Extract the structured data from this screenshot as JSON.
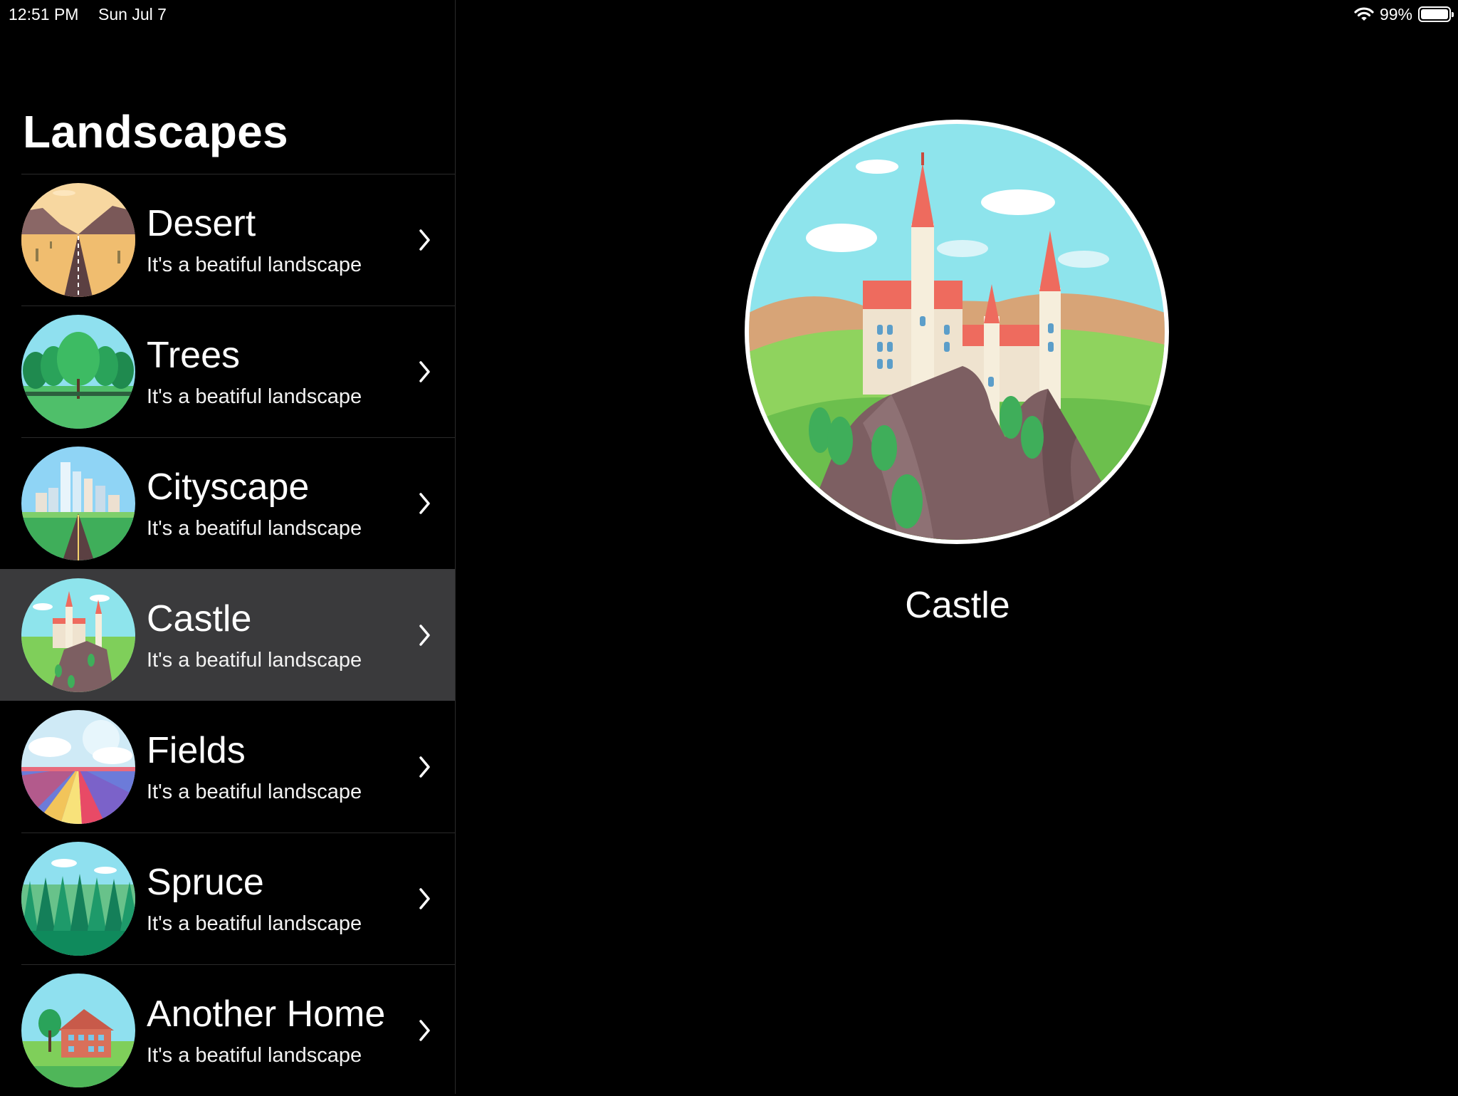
{
  "status_bar": {
    "time": "12:51 PM",
    "date": "Sun Jul 7",
    "battery": "99%",
    "battery_level": 0.99
  },
  "sidebar": {
    "title": "Landscapes",
    "items": [
      {
        "title": "Desert",
        "subtitle": "It's a beatiful landscape",
        "icon": "desert-image",
        "selected": false
      },
      {
        "title": "Trees",
        "subtitle": "It's a beatiful landscape",
        "icon": "trees-image",
        "selected": false
      },
      {
        "title": "Cityscape",
        "subtitle": "It's a beatiful landscape",
        "icon": "cityscape-image",
        "selected": false
      },
      {
        "title": "Castle",
        "subtitle": "It's a beatiful landscape",
        "icon": "castle-image",
        "selected": true
      },
      {
        "title": "Fields",
        "subtitle": "It's a beatiful landscape",
        "icon": "fields-image",
        "selected": false
      },
      {
        "title": "Spruce",
        "subtitle": "It's a beatiful landscape",
        "icon": "spruce-image",
        "selected": false
      },
      {
        "title": "Another Home",
        "subtitle": "It's a beatiful landscape",
        "icon": "home-image",
        "selected": false
      }
    ]
  },
  "detail": {
    "title": "Castle",
    "icon": "castle-image"
  },
  "colors": {
    "background": "#000000",
    "selected_row": "#3a3a3c",
    "separator": "#2a2a2a",
    "text": "#ffffff"
  }
}
